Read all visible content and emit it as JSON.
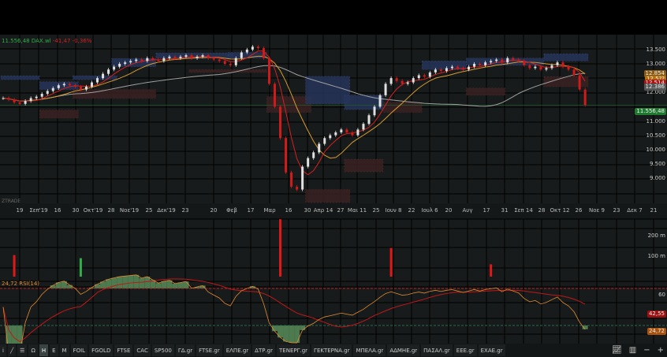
{
  "header": {
    "price": "11.556,48",
    "symbol": "DAX.wl",
    "change": "-41,47",
    "change_pct": "-0,36%"
  },
  "watermark": "ZTRADE",
  "price_axis": [
    "13.500",
    "13.000",
    "12.000",
    "11.000",
    "10.500",
    "10.000",
    "9.500",
    "9.000"
  ],
  "price_tags": [
    {
      "text": "12.854",
      "color": "#8a5a10"
    },
    {
      "text": "12.5??",
      "color": "#b0700e"
    },
    {
      "text": "12.514",
      "color": "#b01515"
    },
    {
      "text": "12.386",
      "color": "#555"
    },
    {
      "text": "11.556,48",
      "color": "#1d7a2e"
    }
  ],
  "volume_axis": [
    "200 m",
    "100 m"
  ],
  "rsi": {
    "label": "24,72 RSI(14)",
    "axis_60": "60",
    "ma_tag": "42,55",
    "value_tag": "24,72",
    "overbought": 70,
    "oversold": 30
  },
  "colors": {
    "up": "#e0e0e0",
    "down": "#d11a1a",
    "ma_fast": "#d42020",
    "ma_mid": "#d49a30",
    "ma_slow": "#a0a0a0",
    "supply": "#26345a",
    "demand": "#3a2222",
    "rsi": "#e08a30",
    "rsi_ma": "#c01818",
    "fill": "#4e7a50"
  },
  "chart_data": {
    "type": "candlestick",
    "symbol": "DAX.wl",
    "ylim": [
      8000,
      13800
    ],
    "x_ticks": [
      "19",
      "Σεπ'19",
      "16",
      "30",
      "Οκτ'19",
      "28",
      "Νοε'19",
      "25",
      "Δεκ'19",
      "23",
      "20",
      "Φεβ",
      "17",
      "Μαρ",
      "16",
      "30",
      "Απρ 14",
      "27",
      "Μαι 11",
      "25",
      "Ιουν 8",
      "22",
      "Ιουλ 6",
      "20",
      "Αυγ",
      "17",
      "31",
      "Σεπ 14",
      "28",
      "Οκτ 12",
      "26",
      "Νοε 9",
      "23",
      "Δεκ 7",
      "21"
    ],
    "closes": [
      11800,
      11750,
      11650,
      11600,
      11700,
      11800,
      11850,
      11950,
      12050,
      12150,
      12250,
      12300,
      12250,
      12200,
      12100,
      12200,
      12350,
      12500,
      12650,
      12800,
      12900,
      13000,
      13050,
      13100,
      13150,
      13100,
      13200,
      13150,
      13100,
      13200,
      13250,
      13200,
      13250,
      13300,
      13200,
      13250,
      13300,
      13200,
      13150,
      13100,
      13000,
      12950,
      13200,
      13400,
      13500,
      13600,
      13550,
      13200,
      12300,
      11500,
      10400,
      9200,
      8700,
      8600,
      9400,
      9700,
      9900,
      10200,
      10400,
      10500,
      10600,
      10700,
      10600,
      10500,
      10700,
      10900,
      11200,
      11500,
      11900,
      12300,
      12500,
      12400,
      12300,
      12350,
      12500,
      12600,
      12550,
      12700,
      12800,
      12750,
      12850,
      12900,
      12850,
      12800,
      12900,
      13000,
      12950,
      13050,
      13100,
      13150,
      13050,
      13200,
      13150,
      13100,
      12950,
      12850,
      12900,
      12800,
      12850,
      12950,
      13050,
      12900,
      12800,
      12600,
      12100,
      11556
    ],
    "zones": [
      {
        "type": "supply",
        "from": 0,
        "to": 6,
        "low": 12450,
        "high": 12580
      },
      {
        "type": "demand",
        "from": 7,
        "to": 13,
        "low": 11100,
        "high": 11380
      },
      {
        "type": "supply",
        "from": 7,
        "to": 13,
        "low": 12100,
        "high": 12370
      },
      {
        "type": "supply",
        "from": 13,
        "to": 20,
        "low": 12450,
        "high": 12580
      },
      {
        "type": "demand",
        "from": 13,
        "to": 27,
        "low": 11790,
        "high": 12100
      },
      {
        "type": "supply",
        "from": 20,
        "to": 27,
        "low": 12900,
        "high": 13190
      },
      {
        "type": "supply",
        "from": 28,
        "to": 41,
        "low": 13190,
        "high": 13380
      },
      {
        "type": "demand",
        "from": 34,
        "to": 47,
        "low": 12700,
        "high": 12800
      },
      {
        "type": "supply",
        "from": 41,
        "to": 47,
        "low": 13200,
        "high": 13400
      },
      {
        "type": "demand",
        "from": 48,
        "to": 55,
        "low": 11300,
        "high": 11850
      },
      {
        "type": "supply",
        "from": 55,
        "to": 62,
        "low": 11600,
        "high": 12560
      },
      {
        "type": "demand",
        "from": 55,
        "to": 62,
        "low": 8150,
        "high": 8600
      },
      {
        "type": "supply",
        "from": 62,
        "to": 68,
        "low": 11400,
        "high": 11900
      },
      {
        "type": "demand",
        "from": 62,
        "to": 68,
        "low": 9220,
        "high": 9660
      },
      {
        "type": "demand",
        "from": 69,
        "to": 75,
        "low": 11300,
        "high": 11650
      },
      {
        "type": "supply",
        "from": 76,
        "to": 83,
        "low": 12800,
        "high": 13100
      },
      {
        "type": "supply",
        "from": 84,
        "to": 97,
        "low": 12950,
        "high": 13200
      },
      {
        "type": "supply",
        "from": 98,
        "to": 105,
        "low": 13100,
        "high": 13350
      },
      {
        "type": "demand",
        "from": 84,
        "to": 90,
        "low": 11900,
        "high": 12150
      },
      {
        "type": "demand",
        "from": 98,
        "to": 105,
        "low": 12200,
        "high": 12550
      }
    ],
    "volume_spikes_m": [
      {
        "index": 2,
        "value": 105,
        "dir": "down"
      },
      {
        "index": 14,
        "value": 90,
        "dir": "up"
      },
      {
        "index": 50,
        "value": 280,
        "dir": "down"
      },
      {
        "index": 70,
        "value": 140,
        "dir": "down"
      },
      {
        "index": 88,
        "value": 60,
        "dir": "down"
      }
    ]
  },
  "toolbar": {
    "items": [
      "Ω",
      "H",
      "E",
      "M",
      "FOIL",
      "FGOLD",
      "FTSE",
      "CAC",
      "SP500",
      "ΓΔ.gr",
      "FTSE.gr",
      "ΕΛΠΕ.gr",
      "ΔΤΡ.gr",
      "ΤΕΝΕΡΓ.gr",
      "ΓΕΚΤΕΡΝΑ.gr",
      "ΜΠΕΛΑ.gr",
      "ΑΔΜΗΕ.gr",
      "ΠΑΣΑΛ.gr",
      "ΕΕΕ.gr",
      "ΕΧΑΕ.gr"
    ],
    "active": "H"
  }
}
